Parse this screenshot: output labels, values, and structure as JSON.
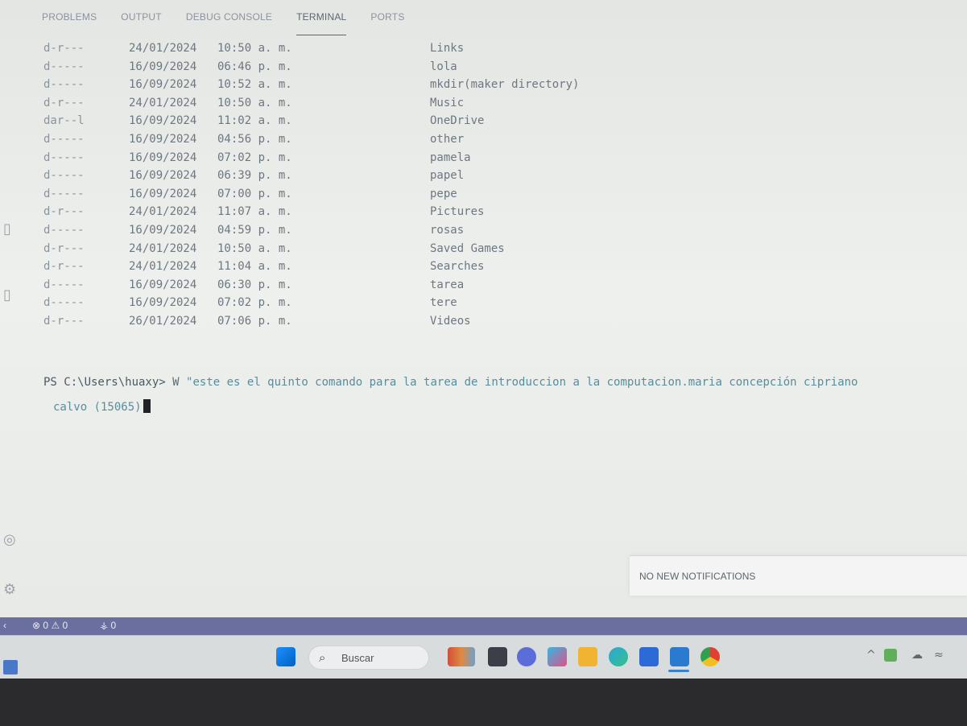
{
  "panel": {
    "tabs": [
      "PROBLEMS",
      "OUTPUT",
      "DEBUG CONSOLE",
      "TERMINAL",
      "PORTS"
    ],
    "active_tab": "TERMINAL"
  },
  "terminal": {
    "rows": [
      {
        "mode": "d-r---",
        "date": "24/01/2024",
        "time": "10:50 a. m.",
        "name": "Links"
      },
      {
        "mode": "d-----",
        "date": "16/09/2024",
        "time": "06:46 p. m.",
        "name": "lola"
      },
      {
        "mode": "d-----",
        "date": "16/09/2024",
        "time": "10:52 a. m.",
        "name": "mkdir(maker directory)"
      },
      {
        "mode": "d-r---",
        "date": "24/01/2024",
        "time": "10:50 a. m.",
        "name": "Music"
      },
      {
        "mode": "dar--l",
        "date": "16/09/2024",
        "time": "11:02 a. m.",
        "name": "OneDrive"
      },
      {
        "mode": "d-----",
        "date": "16/09/2024",
        "time": "04:56 p. m.",
        "name": "other"
      },
      {
        "mode": "d-----",
        "date": "16/09/2024",
        "time": "07:02 p. m.",
        "name": "pamela"
      },
      {
        "mode": "d-----",
        "date": "16/09/2024",
        "time": "06:39 p. m.",
        "name": "papel"
      },
      {
        "mode": "d-----",
        "date": "16/09/2024",
        "time": "07:00 p. m.",
        "name": "pepe"
      },
      {
        "mode": "d-r---",
        "date": "24/01/2024",
        "time": "11:07 a. m.",
        "name": "Pictures"
      },
      {
        "mode": "d-----",
        "date": "16/09/2024",
        "time": "04:59 p. m.",
        "name": "rosas"
      },
      {
        "mode": "d-r---",
        "date": "24/01/2024",
        "time": "10:50 a. m.",
        "name": "Saved Games"
      },
      {
        "mode": "d-r---",
        "date": "24/01/2024",
        "time": "11:04 a. m.",
        "name": "Searches"
      },
      {
        "mode": "d-----",
        "date": "16/09/2024",
        "time": "06:30 p. m.",
        "name": "tarea"
      },
      {
        "mode": "d-----",
        "date": "16/09/2024",
        "time": "07:02 p. m.",
        "name": "tere"
      },
      {
        "mode": "d-r---",
        "date": "26/01/2024",
        "time": "07:06 p. m.",
        "name": "Videos"
      }
    ],
    "prompt": "PS C:\\Users\\huaxy>",
    "command": "W",
    "argument": "\"este es el quinto comando para la tarea de introduccion a la computacion.maria concepción cipriano",
    "argument_cont": "calvo (15065)"
  },
  "notification": {
    "text": "NO NEW NOTIFICATIONS"
  },
  "statusbar": {
    "errors": "0",
    "warnings": "0",
    "ports": "0"
  },
  "taskbar": {
    "search_placeholder": "Buscar"
  },
  "colors": {
    "statusbar": "#6a6fa0",
    "terminal_bg": "#eceeec",
    "string": "#5a8c9a"
  }
}
